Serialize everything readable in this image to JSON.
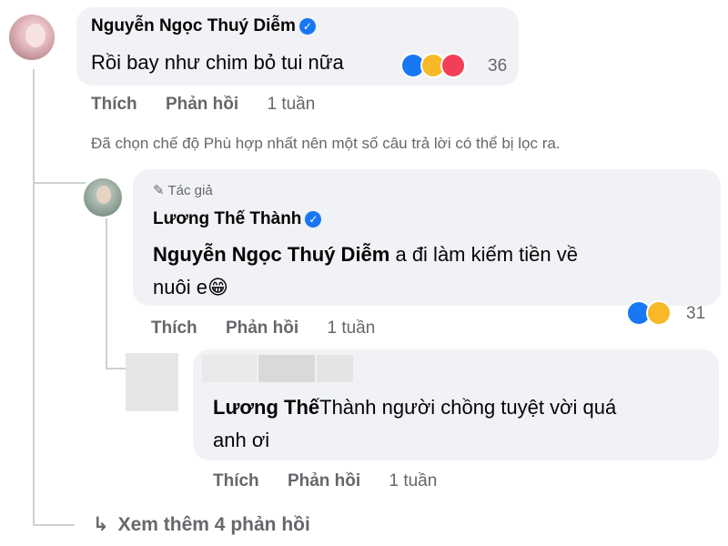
{
  "colors": {
    "bubble_bg": "#f0f2f5",
    "muted_text": "#65676b",
    "verified_blue": "#1877f2",
    "like_blue": "#1877f2",
    "haha_yellow": "#f7b928",
    "love_red": "#f33e58"
  },
  "comment1": {
    "author": "Nguyễn Ngọc Thuý Diễm",
    "text": "Rồi bay như chim bỏ tui nữa",
    "reaction_count": "36",
    "reactions": [
      "like-icon",
      "haha-icon",
      "love-icon"
    ],
    "like_label": "Thích",
    "reply_label": "Phản hồi",
    "time": "1 tuần",
    "filter_notice": "Đã chọn chế độ Phù hợp nhất nên một số câu trả lời có thể bị lọc ra."
  },
  "reply1": {
    "badge": "Tác giả",
    "author": "Lương Thế Thành",
    "mention": "Nguyễn Ngọc Thuý Diễm",
    "text_part1": " a đi làm kiếm tiền về",
    "text_part2": "nuôi e",
    "emoji": "😁",
    "reaction_count": "31",
    "reactions": [
      "like-icon",
      "haha-icon"
    ],
    "like_label": "Thích",
    "reply_label": "Phản hồi",
    "time": "1 tuần"
  },
  "reply2": {
    "mention": "Lương Thế",
    "text_part1": "Thành người chồng tuyệt vời quá",
    "text_part2": "anh ơi",
    "like_label": "Thích",
    "reply_label": "Phản hồi",
    "time": "1 tuần"
  },
  "more_replies": {
    "label": "Xem thêm 4 phản hồi",
    "icon": "reply-arrow-icon"
  }
}
